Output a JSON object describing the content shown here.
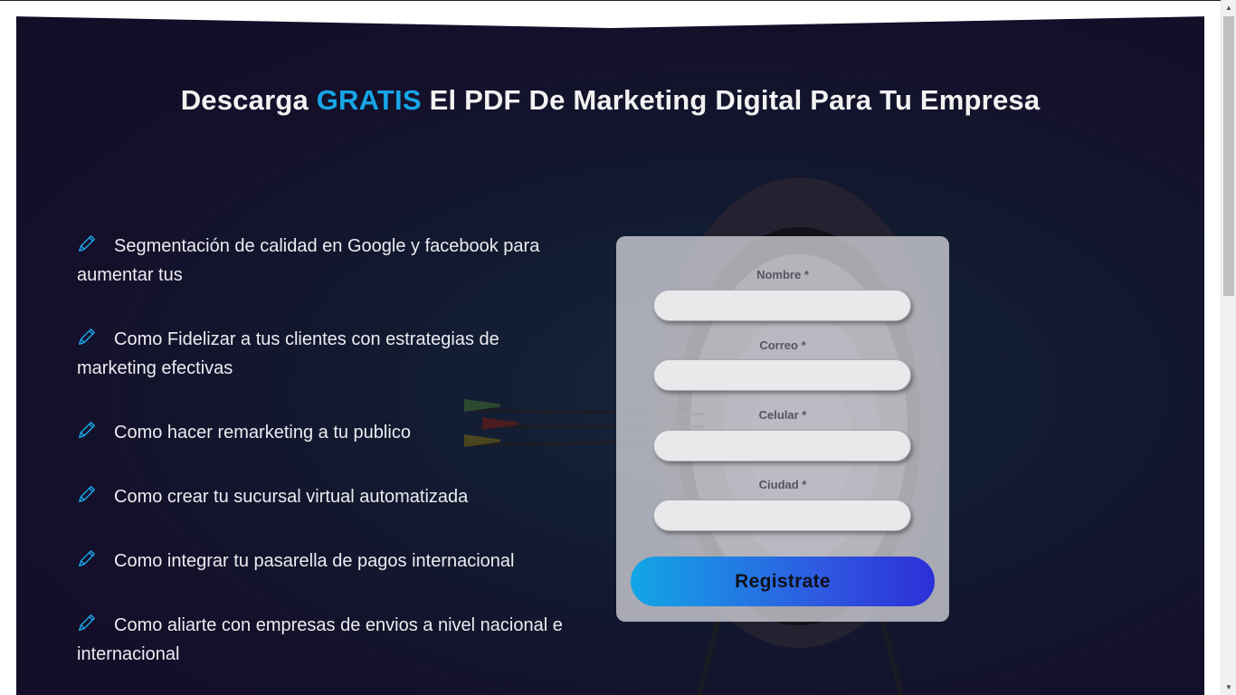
{
  "hero": {
    "title_prefix": "Descarga ",
    "title_accent": "GRATIS",
    "title_suffix": " El PDF De Marketing Digital Para Tu Empresa",
    "accent_color": "#17a5e6"
  },
  "benefits": {
    "icon": "pencil-icon",
    "items": [
      "Segmentación de calidad en Google y facebook para aumentar tus",
      "Como Fidelizar a tus clientes con estrategias de marketing efectivas",
      "Como hacer remarketing a tu publico",
      "Como crear tu sucursal virtual automatizada",
      "Como integrar tu pasarella de pagos internacional",
      "Como aliarte con empresas de envios a nivel nacional e internacional"
    ]
  },
  "form": {
    "fields": [
      {
        "label": "Nombre *",
        "value": ""
      },
      {
        "label": "Correo *",
        "value": ""
      },
      {
        "label": "Celular *",
        "value": ""
      },
      {
        "label": "Ciudad *",
        "value": ""
      }
    ],
    "submit_label": "Registrate",
    "button_gradient": [
      "#12a6e6",
      "#2b2fd8"
    ]
  },
  "scrollbar": {
    "up_icon": "triangle-up-icon",
    "down_icon": "triangle-down-icon"
  }
}
